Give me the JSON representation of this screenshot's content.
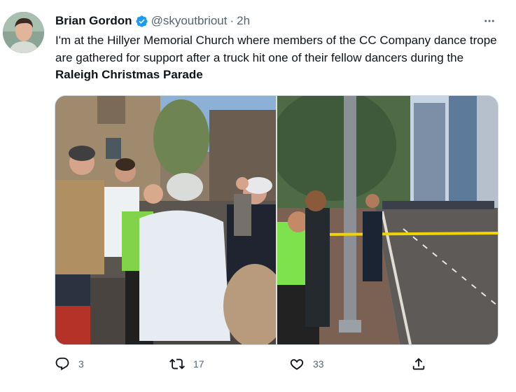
{
  "tweet": {
    "author_name": "Brian Gordon",
    "handle": "@skyoutbriout",
    "separator": "·",
    "time": "2h",
    "text_main": "I'm at the Hillyer Memorial Church where members of the CC Company dance trope are gathered for support after a truck hit one of their fellow dancers during the ",
    "text_bold": "Raleigh Christmas Parade"
  },
  "actions": {
    "replies": "3",
    "retweets": "17",
    "likes": "33"
  },
  "colors": {
    "verified": "#1d9bf0",
    "secondary_text": "#536471",
    "border": "#cfd9de"
  },
  "icons": [
    "verified-icon",
    "more-icon",
    "reply-icon",
    "retweet-icon",
    "like-icon",
    "share-icon"
  ]
}
